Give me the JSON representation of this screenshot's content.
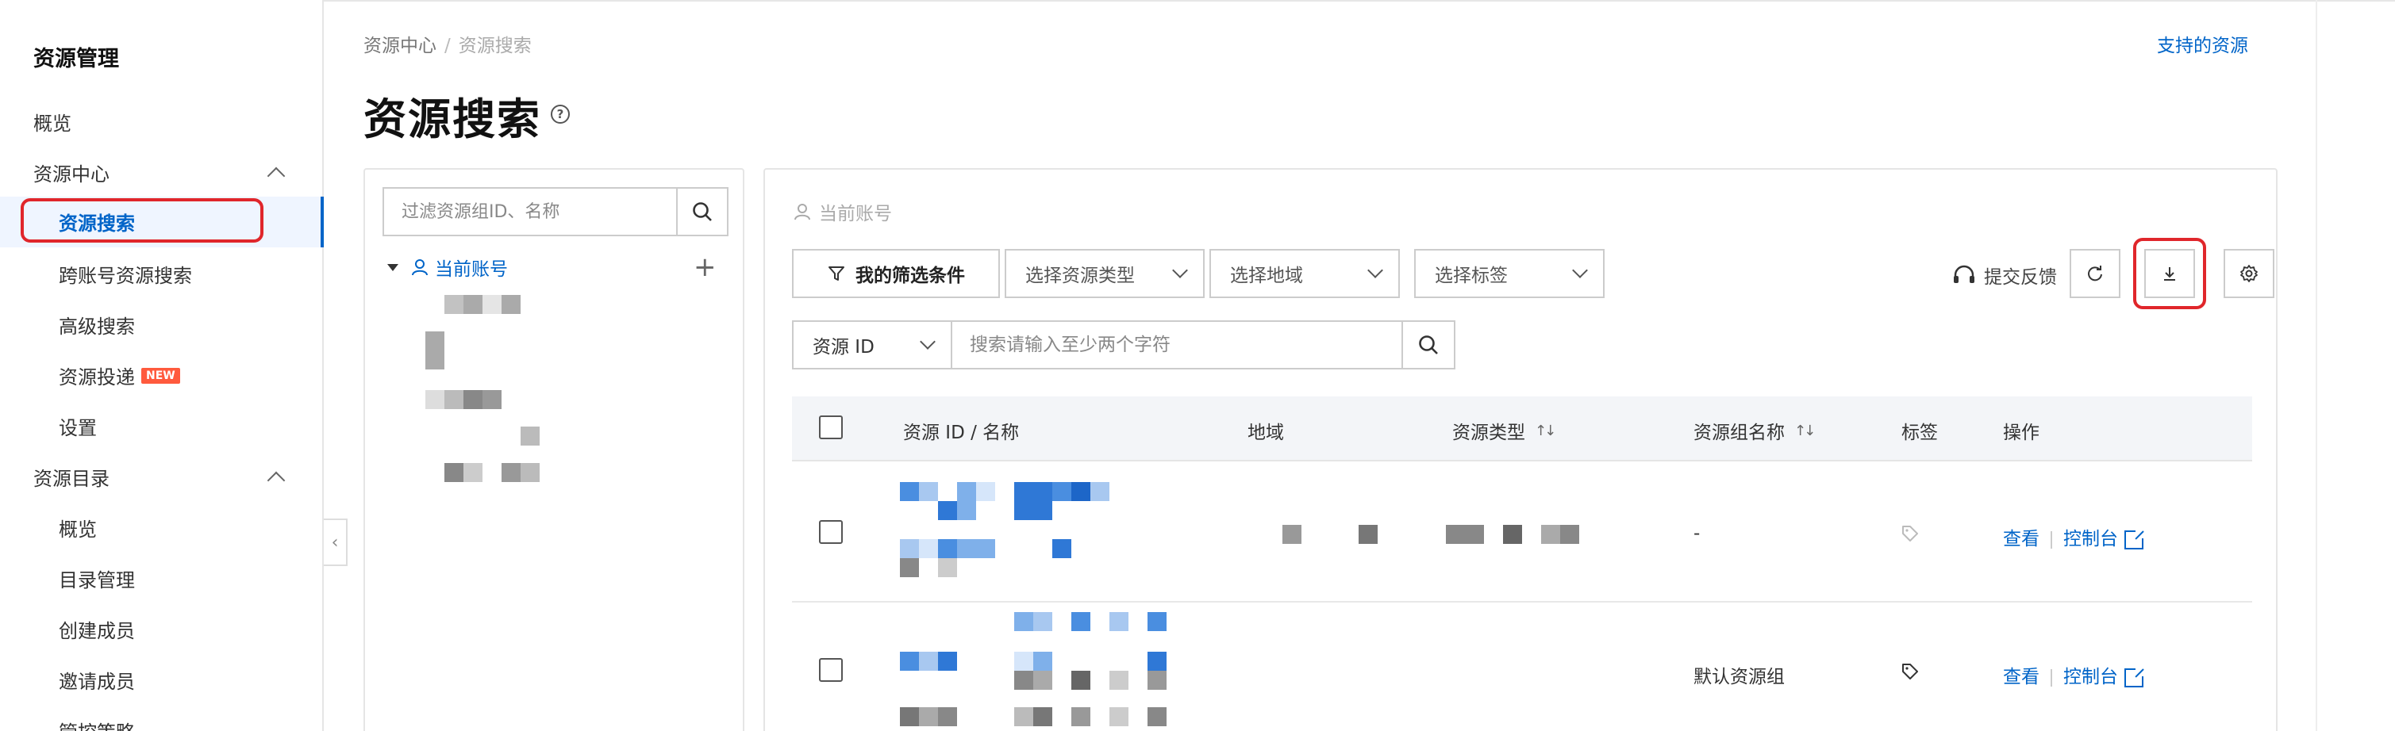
{
  "sidebar": {
    "title": "资源管理",
    "overview": "概览",
    "resource_center": "资源中心",
    "resource_search": "资源搜索",
    "cross_account_search": "跨账号资源搜索",
    "advanced_search": "高级搜索",
    "resource_delivery": "资源投递",
    "new_badge": "NEW",
    "settings": "设置",
    "resource_directory": "资源目录",
    "dir_overview": "概览",
    "dir_management": "目录管理",
    "create_member": "创建成员",
    "invite_member": "邀请成员",
    "control_policy": "管控策略"
  },
  "breadcrumb": {
    "home": "资源中心",
    "separator": "/",
    "current": "资源搜索"
  },
  "page": {
    "title": "资源搜索",
    "supported_resources_link": "支持的资源"
  },
  "left_panel": {
    "search_placeholder": "过滤资源组ID、名称",
    "tree_root": "当前账号"
  },
  "toolbar": {
    "account_label": "当前账号",
    "my_filters": "我的筛选条件",
    "resource_type_placeholder": "选择资源类型",
    "region_placeholder": "选择地域",
    "tag_placeholder": "选择标签",
    "feedback": "提交反馈",
    "search_field": "资源 ID",
    "search_placeholder": "搜索请输入至少两个字符"
  },
  "table": {
    "columns": {
      "id_name": "资源 ID / 名称",
      "region": "地域",
      "resource_type": "资源类型",
      "resource_group": "资源组名称",
      "tags": "标签",
      "actions": "操作"
    },
    "rows": [
      {
        "resource_group": "-",
        "view": "查看",
        "console": "控制台"
      },
      {
        "resource_group": "默认资源组",
        "view": "查看",
        "console": "控制台"
      }
    ]
  },
  "colors": {
    "accent": "#0064c8",
    "highlight": "#e0262b",
    "brand": "#ff6a00"
  }
}
